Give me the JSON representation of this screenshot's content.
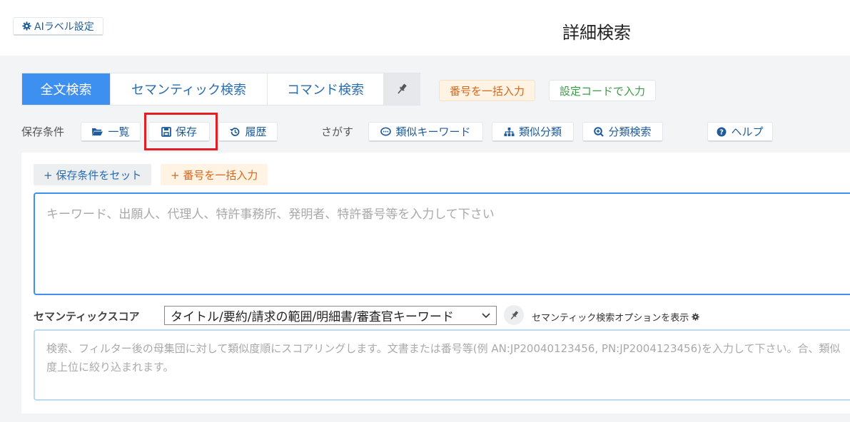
{
  "header": {
    "ai_label_button": "AIラベル設定",
    "title": "詳細検索"
  },
  "tabs": [
    {
      "label": "全文検索",
      "active": true
    },
    {
      "label": "セマンティック検索",
      "active": false
    },
    {
      "label": "コマンド検索",
      "active": false
    }
  ],
  "chips": {
    "bulk_number": "番号を一括入力",
    "setting_code": "設定コードで入力"
  },
  "saved_conditions": {
    "label": "保存条件",
    "list_button": "一覧",
    "save_button": "保存",
    "history_button": "履歴"
  },
  "search_tools": {
    "label": "さがす",
    "similar_keyword": "類似キーワード",
    "similar_class": "類似分類",
    "class_search": "分類検索",
    "help": "ヘルプ"
  },
  "panel": {
    "set_condition_button": "+ 保存条件をセット",
    "bulk_number_button": "+ 番号を一括入力",
    "keyword_placeholder": "キーワード、出願人、代理人、特許事務所、発明者、特許番号等を入力して下さい",
    "semantic_label": "セマンティックスコア",
    "semantic_select_value": "タイトル/要約/請求の範囲/明細書/審査官キーワード",
    "semantic_option_link": "セマンティック検索オプションを表示",
    "semantic_placeholder": "検索、フィルター後の母集団に対して類似度順にスコアリングします。文書または番号等(例 AN:JP20040123456, PN:JP2004123456)を入力して下さい。合、類似度上位に絞り込まれます。"
  },
  "colors": {
    "accent_blue": "#3d8ff0",
    "link_blue": "#1f5c99",
    "orange": "#d9661b",
    "green": "#3a9a45",
    "highlight_red": "#e21d24"
  }
}
